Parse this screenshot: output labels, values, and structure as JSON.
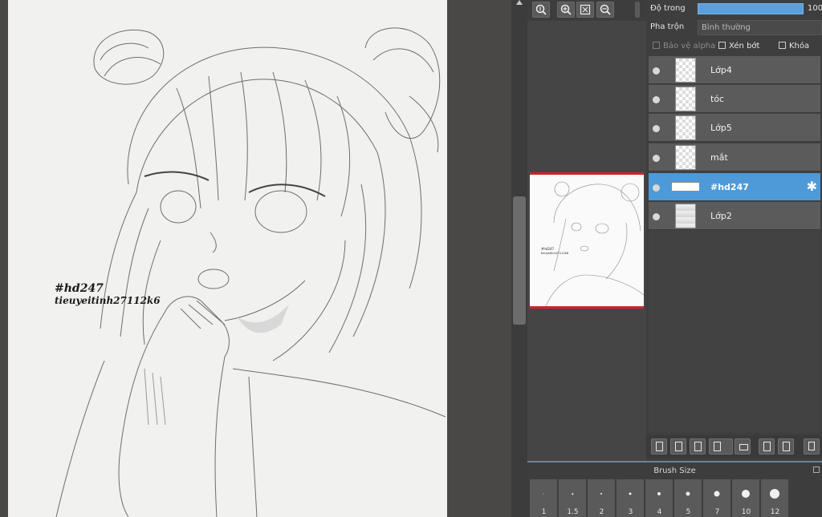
{
  "canvas": {
    "watermark_line1": "#hd247",
    "watermark_line2": "tieuyeitinh27112k6"
  },
  "navigator": {
    "buttons": [
      "zoom-fit-icon",
      "zoom-in-icon",
      "fit-screen-icon",
      "zoom-out-icon"
    ]
  },
  "layers_panel": {
    "opacity_label": "Độ trong",
    "opacity_value": "100",
    "opacity_percent": 100,
    "blend_label": "Pha trộn",
    "blend_value": "Bình thường",
    "protect_alpha": "Bảo vệ alpha",
    "clipping": "Xén bớt",
    "lock": "Khóa",
    "layers": [
      {
        "name": "Lớp4"
      },
      {
        "name": "tóc"
      },
      {
        "name": "Lớp5"
      },
      {
        "name": "mắt"
      },
      {
        "name": "#hd247",
        "selected": true
      },
      {
        "name": "Lớp2"
      }
    ]
  },
  "brush_panel": {
    "title": "Brush Size",
    "sizes": [
      "1",
      "1.5",
      "2",
      "3",
      "4",
      "5",
      "7",
      "10",
      "12"
    ]
  },
  "colors": {
    "accent": "#4e9ad8",
    "preview_border": "#c8282a"
  }
}
